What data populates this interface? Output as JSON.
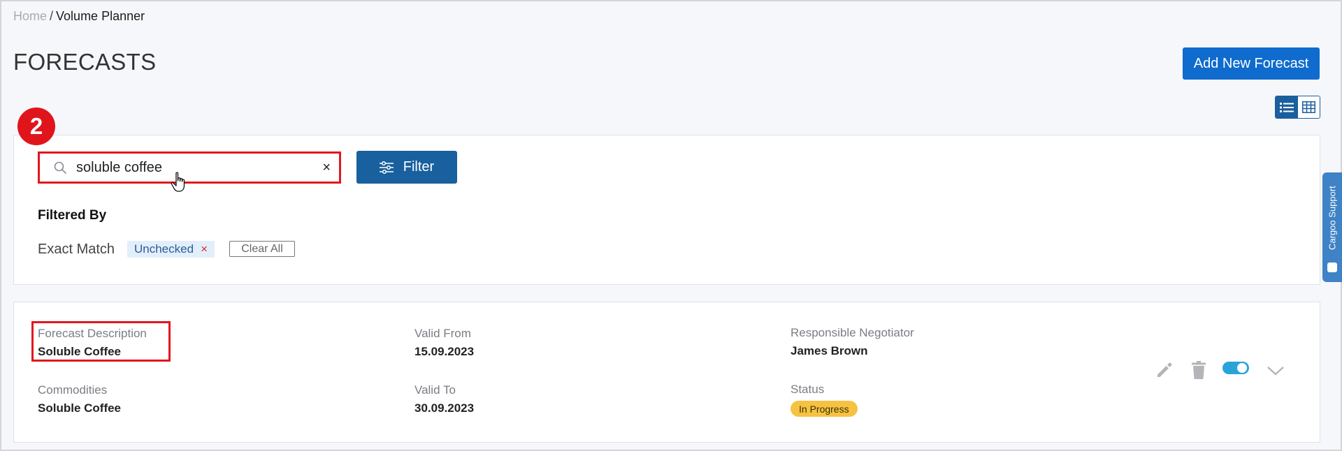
{
  "breadcrumb": {
    "home": "Home",
    "separator": "/",
    "current": "Volume Planner"
  },
  "page": {
    "title": "FORECASTS",
    "add_button_label": "Add New Forecast"
  },
  "annotation": {
    "step": "2"
  },
  "search": {
    "value": "soluble coffee",
    "clear_glyph": "×"
  },
  "filter": {
    "button_label": "Filter",
    "filtered_by_label": "Filtered By",
    "exact_match_label": "Exact Match",
    "chip_label": "Unchecked",
    "chip_remove": "×",
    "clear_all_label": "Clear All"
  },
  "result": {
    "forecast_description_label": "Forecast Description",
    "forecast_description": "Soluble Coffee",
    "commodities_label": "Commodities",
    "commodities": "Soluble Coffee",
    "valid_from_label": "Valid From",
    "valid_from": "15.09.2023",
    "valid_to_label": "Valid To",
    "valid_to": "30.09.2023",
    "negotiator_label": "Responsible Negotiator",
    "negotiator": "James Brown",
    "status_label": "Status",
    "status": "In Progress",
    "active": true
  },
  "support": {
    "label": "Cargoo Support"
  },
  "icons": [
    "search-icon",
    "clear-icon",
    "filter-sliders-icon",
    "list-view-icon",
    "grid-view-icon",
    "pencil-icon",
    "trash-icon",
    "chevron-down-icon",
    "chat-icon",
    "pointer-hand-icon"
  ],
  "colors": {
    "primary": "#0f6bce",
    "filter_button": "#18609e",
    "highlight": "#e3161e",
    "status_badge": "#f6c242",
    "toggle": "#2aa3d8"
  }
}
